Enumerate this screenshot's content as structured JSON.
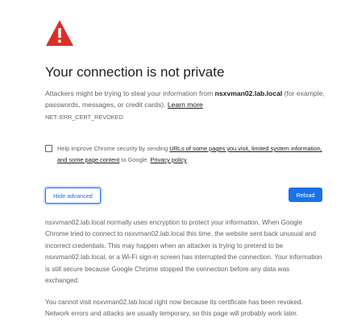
{
  "icon": "warning-triangle-icon",
  "title": "Your connection is not private",
  "description": {
    "before": "Attackers might be trying to steal your information from ",
    "host": "nsxvman02.lab.local",
    "after": " (for example, passwords, messages, or credit cards). ",
    "learn_more": "Learn more"
  },
  "error_code": "NET::ERR_CERT_REVOKED",
  "optin": {
    "text1": "Help improve Chrome security by sending ",
    "link1": "URLs of some pages you visit, limited system information, and some page content",
    "text2": " to Google. ",
    "link2": "Privacy policy"
  },
  "buttons": {
    "advanced": "Hide advanced",
    "reload": "Reload"
  },
  "details": {
    "paragraph1": "nsxvman02.lab.local normally uses encryption to protect your information. When Google Chrome tried to connect to nsxvman02.lab.local this time, the website sent back unusual and incorrect credentials. This may happen when an attacker is trying to pretend to be nsxvman02.lab.local, or a Wi-Fi sign-in screen has interrupted the connection. Your information is still secure because Google Chrome stopped the connection before any data was exchanged.",
    "paragraph2": "You cannot visit nsxvman02.lab.local right now because its certificate has been revoked. Network errors and attacks are usually temporary, so this page will probably work later."
  },
  "colors": {
    "icon_red": "#d93025",
    "accent_blue": "#1a73e8"
  }
}
